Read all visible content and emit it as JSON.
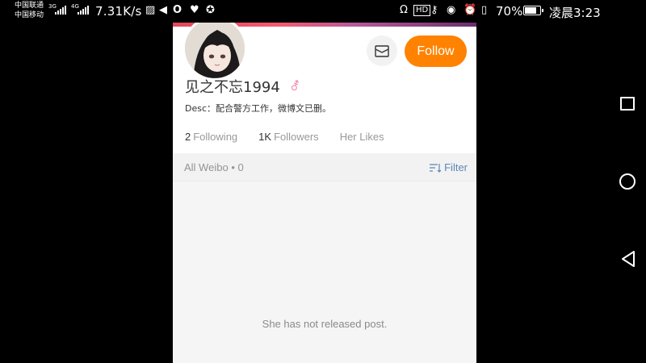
{
  "status_bar": {
    "carrier_1": "中国联通",
    "carrier_1_net": "3G",
    "carrier_2": "中国移动",
    "carrier_2_net": "4G",
    "net_speed": "7.31K/s",
    "battery": "70%",
    "time": "凌晨3:23"
  },
  "profile": {
    "name": "见之不忘1994",
    "gender_symbol": "⚦",
    "description": "Desc：配合警方工作，微博文已删。",
    "follow_label": "Follow",
    "stats": {
      "following_count": "2",
      "following_label": "Following",
      "followers_count": "1K",
      "followers_label": "Followers",
      "likes_label": "Her Likes"
    }
  },
  "feed": {
    "tab_label": "All Weibo",
    "separator": "•",
    "count": "0",
    "filter_label": "Filter",
    "empty_message": "She has not released post."
  },
  "colors": {
    "follow_button": "#ff8200",
    "filter_link": "#5c86b8",
    "background": "#000000"
  },
  "icons": [
    "message-icon",
    "gender-icon",
    "filter-icon",
    "recent-apps-icon",
    "home-icon",
    "back-icon"
  ]
}
